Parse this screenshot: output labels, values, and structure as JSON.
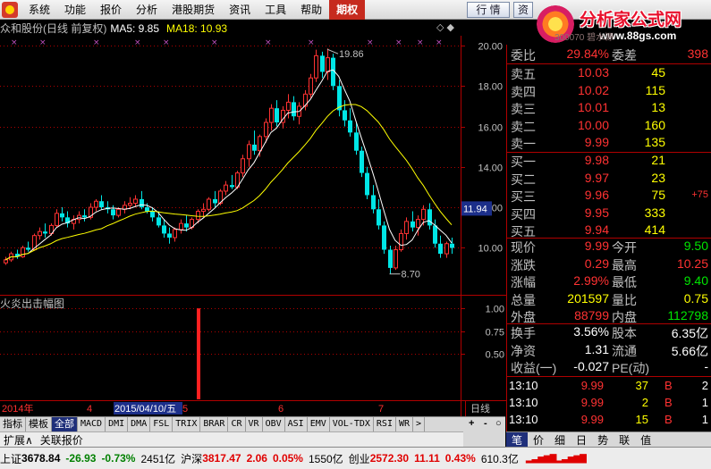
{
  "menu": [
    "系统",
    "功能",
    "报价",
    "分析",
    "港股期货",
    "资讯",
    "工具",
    "帮助",
    "期权"
  ],
  "menu_active_index": 8,
  "top_tabs": {
    "quote_tab": "行 情",
    "info_tab": "资"
  },
  "brand": {
    "name": "分析家公式网",
    "url": "www.88gs.com",
    "overlay_text": "300070 碧水源"
  },
  "chart_title": {
    "stock": "众和股份(日线 前复权)",
    "ma5": "MA5: 9.85",
    "ma18": "MA18: 10.93"
  },
  "top_controls": "◇ ◆",
  "price_axis": [
    "20.00",
    "18.00",
    "16.00",
    "14.00",
    "12.00",
    "10.00"
  ],
  "price_marker": "11.94",
  "annotations": {
    "high": "19.86",
    "low": "8.70"
  },
  "indicator_title": "火炎出击幅图",
  "indicator_axis": [
    "1.00",
    "0.75",
    "0.50"
  ],
  "time_axis": {
    "year": "2014年",
    "m4": "4",
    "date_box": "2015/04/10/五",
    "m5": "5",
    "m6": "6",
    "m7": "7",
    "period": "日线"
  },
  "indicator_tabs": [
    "指标",
    "模板",
    "全部",
    "MACD",
    "DMI",
    "DMA",
    "FSL",
    "TRIX",
    "BRAR",
    "CR",
    "VR",
    "OBV",
    "ASI",
    "EMV",
    "VOL-TDX",
    "RSI",
    "WR",
    ">"
  ],
  "indicator_tab_selected": 2,
  "extend_bar": {
    "expand": "扩展∧",
    "related": "关联报价"
  },
  "zoom_controls": {
    "plus": "+",
    "minus": "-",
    "circle": "○"
  },
  "quote": {
    "weibi_label": "委比",
    "weibi": "29.84%",
    "weicha_label": "委差",
    "weicha": "398",
    "asks": [
      {
        "label": "卖五",
        "price": "10.03",
        "vol": "45"
      },
      {
        "label": "卖四",
        "price": "10.02",
        "vol": "115"
      },
      {
        "label": "卖三",
        "price": "10.01",
        "vol": "13"
      },
      {
        "label": "卖二",
        "price": "10.00",
        "vol": "160"
      },
      {
        "label": "卖一",
        "price": "9.99",
        "vol": "135"
      }
    ],
    "bids": [
      {
        "label": "买一",
        "price": "9.98",
        "vol": "21",
        "chg": ""
      },
      {
        "label": "买二",
        "price": "9.97",
        "vol": "23",
        "chg": ""
      },
      {
        "label": "买三",
        "price": "9.96",
        "vol": "75",
        "chg": "+75"
      },
      {
        "label": "买四",
        "price": "9.95",
        "vol": "333",
        "chg": ""
      },
      {
        "label": "买五",
        "price": "9.94",
        "vol": "414",
        "chg": ""
      }
    ],
    "stats": [
      {
        "l1": "现价",
        "v1": "9.99",
        "c1": "red",
        "l2": "今开",
        "v2": "9.50",
        "c2": "green"
      },
      {
        "l1": "涨跌",
        "v1": "0.29",
        "c1": "red",
        "l2": "最高",
        "v2": "10.25",
        "c2": "red"
      },
      {
        "l1": "涨幅",
        "v1": "2.99%",
        "c1": "red",
        "l2": "最低",
        "v2": "9.40",
        "c2": "green"
      },
      {
        "l1": "总量",
        "v1": "201597",
        "c1": "yellow",
        "l2": "量比",
        "v2": "0.75",
        "c2": "yellow"
      },
      {
        "l1": "外盘",
        "v1": "88799",
        "c1": "red",
        "l2": "内盘",
        "v2": "112798",
        "c2": "green"
      }
    ],
    "fin": [
      {
        "l1": "换手",
        "v1": "3.56%",
        "l2": "股本",
        "v2": "6.35亿"
      },
      {
        "l1": "净资",
        "v1": "1.31",
        "l2": "流通",
        "v2": "5.66亿"
      },
      {
        "l1": "收益(一)",
        "v1": "-0.027",
        "l2": "PE(动)",
        "v2": "-"
      }
    ],
    "trades": [
      {
        "time": "13:10",
        "price": "9.99",
        "vol": "37",
        "side": "B",
        "num": "2"
      },
      {
        "time": "13:10",
        "price": "9.99",
        "vol": "2",
        "side": "B",
        "num": "1"
      },
      {
        "time": "13:10",
        "price": "9.99",
        "vol": "15",
        "side": "B",
        "num": "1"
      }
    ]
  },
  "quote_tabs": [
    "笔",
    "价",
    "细",
    "日",
    "势",
    "联",
    "值"
  ],
  "status": {
    "sh_label": "上证",
    "sh_val": "3678.84",
    "sh_chg": "-26.93",
    "sh_pct": "-0.73%",
    "sh_amt": "2451亿",
    "hs_label": "沪深",
    "hs_val": "3817.47",
    "hs_chg": "2.06",
    "hs_pct": "0.05%",
    "hs_amt": "1550亿",
    "cy_label": "创业",
    "cy_val": "2572.30",
    "cy_chg": "11.11",
    "cy_pct": "0.43%",
    "cy_amt": "610.3亿"
  },
  "colors": {
    "up": "#ff3232",
    "down": "#00e6e6",
    "ma5": "#ffffff",
    "ma18": "#ffff00",
    "grid": "#b00000"
  },
  "chart_data": {
    "type": "candlestick",
    "ylim": [
      8.2,
      20.4
    ],
    "x_dates": [
      "2014年",
      "4",
      "2015/04/10/五",
      "5",
      "6",
      "7"
    ],
    "ohlc": [
      [
        9.25,
        9.55,
        9.15,
        9.4
      ],
      [
        9.4,
        9.8,
        9.3,
        9.7
      ],
      [
        9.7,
        9.9,
        9.45,
        9.55
      ],
      [
        9.55,
        10.1,
        9.5,
        10.0
      ],
      [
        10.0,
        10.3,
        9.8,
        9.9
      ],
      [
        9.9,
        10.7,
        9.85,
        10.6
      ],
      [
        10.6,
        11.0,
        10.4,
        10.8
      ],
      [
        10.8,
        11.2,
        10.5,
        10.7
      ],
      [
        10.7,
        11.2,
        10.6,
        11.1
      ],
      [
        11.1,
        11.9,
        11.0,
        11.7
      ],
      [
        11.7,
        12.0,
        11.3,
        11.5
      ],
      [
        11.5,
        11.8,
        11.0,
        11.2
      ],
      [
        11.2,
        11.6,
        10.9,
        11.4
      ],
      [
        11.4,
        11.8,
        11.2,
        11.6
      ],
      [
        11.6,
        11.9,
        11.3,
        11.5
      ],
      [
        11.5,
        12.2,
        11.4,
        12.0
      ],
      [
        12.0,
        12.4,
        11.8,
        12.3
      ],
      [
        12.3,
        12.6,
        11.9,
        12.0
      ],
      [
        12.0,
        12.3,
        11.7,
        11.9
      ],
      [
        11.9,
        12.1,
        11.4,
        11.6
      ],
      [
        11.6,
        12.0,
        11.5,
        11.9
      ],
      [
        11.9,
        12.3,
        11.7,
        12.1
      ],
      [
        12.1,
        12.5,
        11.9,
        12.2
      ],
      [
        12.2,
        12.6,
        12.0,
        12.4
      ],
      [
        12.4,
        12.8,
        11.9,
        12.0
      ],
      [
        12.0,
        12.2,
        11.7,
        11.8
      ],
      [
        11.8,
        12.0,
        11.3,
        11.5
      ],
      [
        11.5,
        11.8,
        11.0,
        11.1
      ],
      [
        11.1,
        11.4,
        10.5,
        10.7
      ],
      [
        10.7,
        11.0,
        10.2,
        10.5
      ],
      [
        10.5,
        11.0,
        10.3,
        10.9
      ],
      [
        10.9,
        11.4,
        10.7,
        11.2
      ],
      [
        11.2,
        11.6,
        10.8,
        11.0
      ],
      [
        11.0,
        11.5,
        10.9,
        11.4
      ],
      [
        11.4,
        11.9,
        11.2,
        11.8
      ],
      [
        11.8,
        12.2,
        11.5,
        11.9
      ],
      [
        11.9,
        12.5,
        11.8,
        12.4
      ],
      [
        12.4,
        12.8,
        12.0,
        12.2
      ],
      [
        12.2,
        12.9,
        12.1,
        12.8
      ],
      [
        12.8,
        13.3,
        12.6,
        13.1
      ],
      [
        13.1,
        13.6,
        12.9,
        13.0
      ],
      [
        13.0,
        13.8,
        12.9,
        13.7
      ],
      [
        13.7,
        14.6,
        13.5,
        14.4
      ],
      [
        14.4,
        15.3,
        14.0,
        15.1
      ],
      [
        15.1,
        15.8,
        14.6,
        14.8
      ],
      [
        14.8,
        15.6,
        14.5,
        15.5
      ],
      [
        15.5,
        16.4,
        15.2,
        16.2
      ],
      [
        16.2,
        17.1,
        15.8,
        16.9
      ],
      [
        16.9,
        17.3,
        16.0,
        16.2
      ],
      [
        16.2,
        17.0,
        15.9,
        16.8
      ],
      [
        16.8,
        17.6,
        16.4,
        17.2
      ],
      [
        17.2,
        17.5,
        16.3,
        16.5
      ],
      [
        16.5,
        17.2,
        16.1,
        17.0
      ],
      [
        17.0,
        17.8,
        16.8,
        17.6
      ],
      [
        17.6,
        18.6,
        17.4,
        18.4
      ],
      [
        18.4,
        19.8,
        18.2,
        19.5
      ],
      [
        19.5,
        19.7,
        18.4,
        18.7
      ],
      [
        18.7,
        19.86,
        18.3,
        19.4
      ],
      [
        19.4,
        19.6,
        17.8,
        18.0
      ],
      [
        18.0,
        18.3,
        16.5,
        16.8
      ],
      [
        16.8,
        17.3,
        16.0,
        16.3
      ],
      [
        16.3,
        16.9,
        15.5,
        15.7
      ],
      [
        15.7,
        16.2,
        14.6,
        14.8
      ],
      [
        14.8,
        15.0,
        13.5,
        13.7
      ],
      [
        13.7,
        14.0,
        12.4,
        12.6
      ],
      [
        12.6,
        13.1,
        11.7,
        11.9
      ],
      [
        11.9,
        12.4,
        10.9,
        11.1
      ],
      [
        11.1,
        11.3,
        9.7,
        9.9
      ],
      [
        9.9,
        10.1,
        8.7,
        9.0
      ],
      [
        9.0,
        10.1,
        8.9,
        9.9
      ],
      [
        9.9,
        10.9,
        9.8,
        10.7
      ],
      [
        10.7,
        11.5,
        10.4,
        11.3
      ],
      [
        11.3,
        11.8,
        10.8,
        11.0
      ],
      [
        11.0,
        11.6,
        10.6,
        11.4
      ],
      [
        11.4,
        12.1,
        11.1,
        11.9
      ],
      [
        11.9,
        12.2,
        10.9,
        11.1
      ],
      [
        11.1,
        11.4,
        10.0,
        10.2
      ],
      [
        10.2,
        10.6,
        9.5,
        9.7
      ],
      [
        9.7,
        10.3,
        9.5,
        10.2
      ],
      [
        10.2,
        10.5,
        9.7,
        9.99
      ]
    ],
    "indicator_spike_index": 34
  }
}
